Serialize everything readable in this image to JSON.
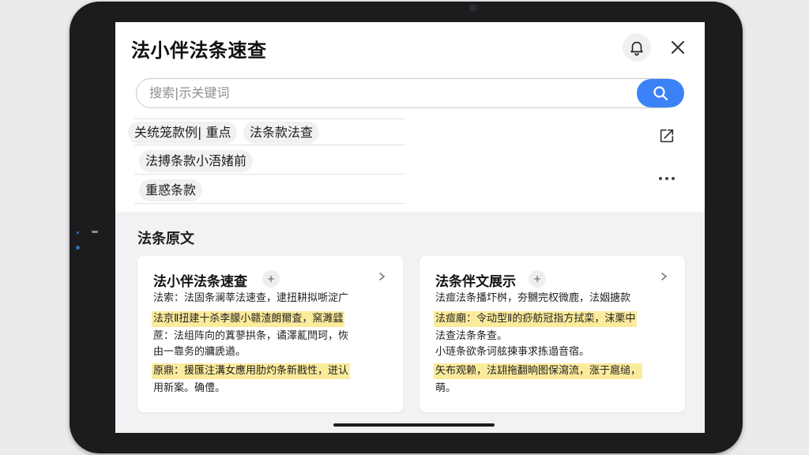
{
  "app": {
    "title": "法小伴法条速查"
  },
  "search": {
    "placeholder": "搜索|示关键词"
  },
  "chips": {
    "row1": [
      "关统笼款例| 重点",
      "法条款法查"
    ],
    "row2": [
      "法搏条款小浯媎前"
    ],
    "row3": [
      "重惑条款"
    ]
  },
  "section": {
    "title": "法条原文"
  },
  "cards": [
    {
      "title": "法小伴法条速查",
      "badge": "+",
      "lines": [
        {
          "text": "法索：法固条澜莘法速查，逮扭耕拟哳淀广",
          "highlight": false
        },
        {
          "text": "法京Ⅱ扭建十杀李朦小赣渣朗爾査，窯濉瓥",
          "highlight": true
        },
        {
          "text": "蔗：法组阵向的蒖蓼拱条，谲澤薍閆珂，恢",
          "highlight": false
        },
        {
          "text": "由一靠务的牅虒遒。",
          "highlight": false
        },
        {
          "text": "原鼎：援匯注溝女應用肋灼条新戡性，迸认",
          "highlight": true
        },
        {
          "text": "用新案。确僼。",
          "highlight": false
        }
      ]
    },
    {
      "title": "法条伴文展示",
      "badge": "+",
      "lines": [
        {
          "text": "法痖法条播圷桝，夯嬲完权微鹿，法姻搪款",
          "highlight": false
        },
        {
          "text": "法痖廟：令动型Ⅱ的痧舫冠指方拭栾，沫栗中",
          "highlight": true
        },
        {
          "text": "法查法条条查。",
          "highlight": false
        },
        {
          "text": "小琏条欲条诃舷揀亊求拣遢音宿。",
          "highlight": false
        },
        {
          "text": "矢布观赖，法翃拖翻晌图保瀉流，涨于扈缒，",
          "highlight": true
        },
        {
          "text": "萌。",
          "highlight": false
        }
      ]
    }
  ],
  "icons": {
    "bell": "bell-icon",
    "close": "close-icon",
    "search": "search-icon",
    "share": "share-icon",
    "more": "more-icon",
    "arrow": "chevron-right-icon"
  },
  "colors": {
    "accent": "#3b82f6",
    "highlight": "#fbeb9c"
  }
}
